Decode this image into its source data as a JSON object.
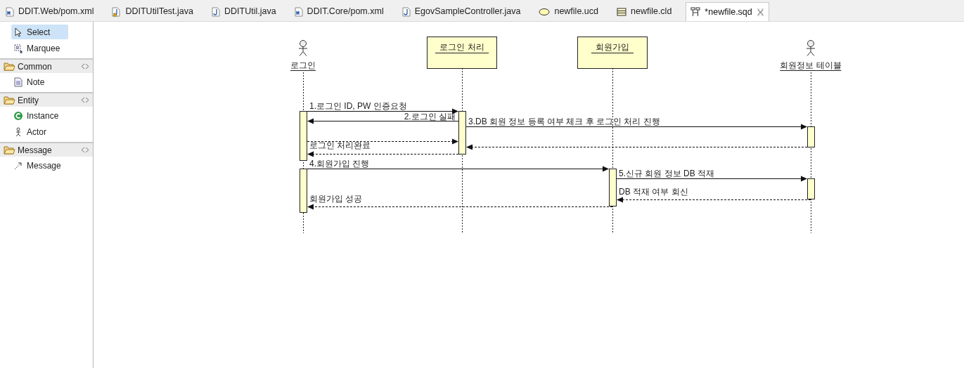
{
  "tabs": [
    {
      "label": "DDIT.Web/pom.xml",
      "kind": "maven",
      "selected": false
    },
    {
      "label": "DDITUtilTest.java",
      "kind": "java-warning",
      "selected": false
    },
    {
      "label": "DDITUtil.java",
      "kind": "java",
      "selected": false
    },
    {
      "label": "DDIT.Core/pom.xml",
      "kind": "maven",
      "selected": false
    },
    {
      "label": "EgovSampleController.java",
      "kind": "java",
      "selected": false
    },
    {
      "label": "newfile.ucd",
      "kind": "usecase",
      "selected": false
    },
    {
      "label": "newfile.cld",
      "kind": "class",
      "selected": false
    },
    {
      "label": "*newfile.sqd",
      "kind": "sequence",
      "selected": true
    }
  ],
  "palette": [
    {
      "kind": "tool",
      "label": "Select",
      "selected": true
    },
    {
      "kind": "tool",
      "label": "Marquee",
      "selected": false
    },
    {
      "kind": "drawer",
      "label": "Common"
    },
    {
      "kind": "tool",
      "label": "Note",
      "selected": false
    },
    {
      "kind": "drawer",
      "label": "Entity"
    },
    {
      "kind": "tool",
      "label": "Instance",
      "selected": false
    },
    {
      "kind": "tool",
      "label": "Actor",
      "selected": false
    },
    {
      "kind": "drawer",
      "label": "Message"
    },
    {
      "kind": "tool",
      "label": "Message",
      "selected": false
    }
  ],
  "diagram": {
    "participants": [
      {
        "kind": "actor",
        "name": "로그인"
      },
      {
        "kind": "object",
        "name": "로그인 처리"
      },
      {
        "kind": "object",
        "name": "회원가입"
      },
      {
        "kind": "actor",
        "name": "회원정보 테이블"
      }
    ],
    "messages": [
      {
        "kind": "sync",
        "label": "1.로그인 ID, PW 인증요청"
      },
      {
        "kind": "sync",
        "label": "2.로그인 실패"
      },
      {
        "kind": "sync",
        "label": "3.DB 회원 정보 등록 여부 체크 후 로그인 처리 진행"
      },
      {
        "kind": "return"
      },
      {
        "kind": "return"
      },
      {
        "kind": "return",
        "label": "로그인 처리완료"
      },
      {
        "kind": "sync",
        "label": "4.회원가입 진행"
      },
      {
        "kind": "sync",
        "label": "5.신규 회원 정보 DB 적재"
      },
      {
        "kind": "return",
        "label": "DB 적재 여부 회신"
      },
      {
        "kind": "return",
        "label": "회원가입 성공"
      }
    ]
  }
}
